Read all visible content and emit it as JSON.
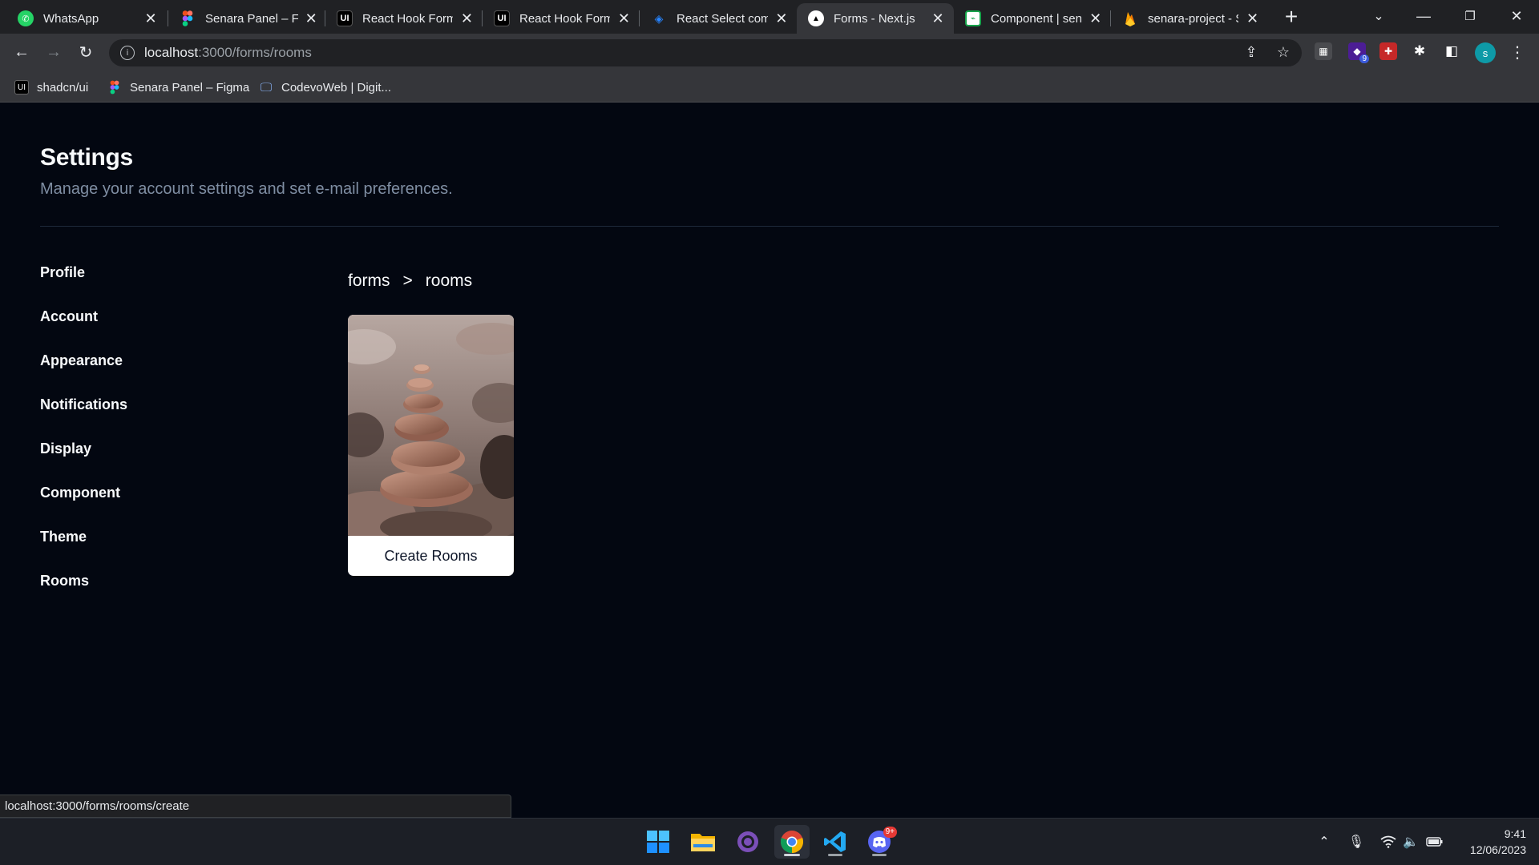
{
  "browser": {
    "tabs": [
      {
        "title": "WhatsApp",
        "icon": "whatsapp-icon",
        "icon_color": "#25d366",
        "active": false
      },
      {
        "title": "Senara Panel – Figma",
        "icon": "figma-icon",
        "icon_color": "#f24e1e",
        "active": false
      },
      {
        "title": "React Hook Form",
        "icon": "shadcn-icon",
        "icon_color": "#000000",
        "active": false
      },
      {
        "title": "React Hook Form",
        "icon": "shadcn-icon",
        "icon_color": "#000000",
        "active": false
      },
      {
        "title": "React Select comp",
        "icon": "react-select-icon",
        "icon_color": "#2684ff",
        "active": false
      },
      {
        "title": "Forms - Next.js",
        "icon": "nextjs-icon",
        "icon_color": "#000000",
        "active": true
      },
      {
        "title": "Component | sena",
        "icon": "component-icon",
        "icon_color": "#22c55e",
        "active": false
      },
      {
        "title": "senara-project - S",
        "icon": "firebase-icon",
        "icon_color": "#ffca28",
        "active": false
      }
    ],
    "address": {
      "host": "localhost",
      "path": ":3000/forms/rooms"
    },
    "bookmarks": [
      {
        "label": "shadcn/ui",
        "icon": "shadcn-icon"
      },
      {
        "label": "Senara Panel – Figma",
        "icon": "figma-icon"
      },
      {
        "label": "CodevoWeb | Digit...",
        "icon": "monitor-icon"
      }
    ],
    "extension_badge": "9",
    "profile_initial": "s",
    "status_url": "localhost:3000/forms/rooms/create"
  },
  "settings": {
    "title": "Settings",
    "subtitle": "Manage your account settings and set e-mail preferences.",
    "nav": [
      {
        "label": "Profile"
      },
      {
        "label": "Account"
      },
      {
        "label": "Appearance"
      },
      {
        "label": "Notifications"
      },
      {
        "label": "Display"
      },
      {
        "label": "Component"
      },
      {
        "label": "Theme"
      },
      {
        "label": "Rooms"
      }
    ]
  },
  "breadcrumb": {
    "items": [
      "forms",
      "rooms"
    ],
    "separator": ">"
  },
  "room_card": {
    "label": "Create Rooms",
    "image": "stacked-stones-photo"
  },
  "taskbar": {
    "apps": [
      "windows-start-icon",
      "file-explorer-icon",
      "github-desktop-icon",
      "chrome-icon",
      "vscode-icon",
      "discord-icon"
    ],
    "discord_badge": "9+",
    "time": "9:41",
    "date": "12/06/2023"
  },
  "colors": {
    "page_bg": "#030711",
    "text": "#f8fafc",
    "muted": "#7f8ea3",
    "border": "#1e293b"
  }
}
